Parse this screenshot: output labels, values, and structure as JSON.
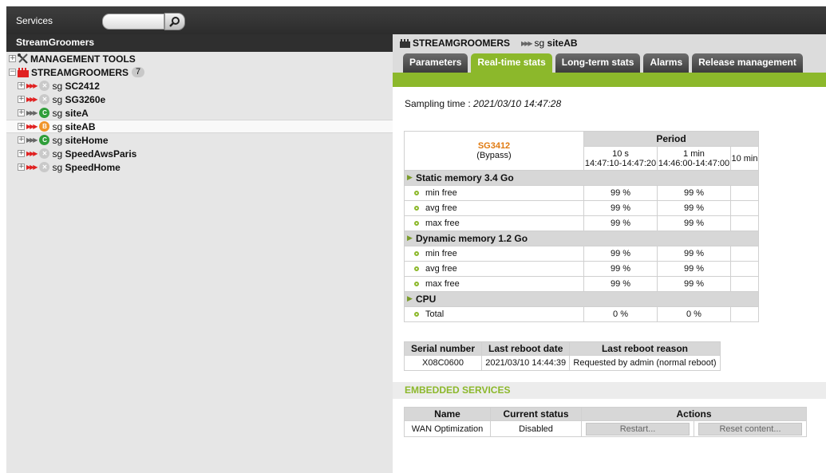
{
  "topbar": {
    "services_label": "Services",
    "search_placeholder": ""
  },
  "left": {
    "header": "StreamGroomers",
    "tree": {
      "management": "MANAGEMENT TOOLS",
      "root": {
        "label": "STREAMGROOMERS",
        "count": "7"
      },
      "items": [
        {
          "prefix": "sg",
          "name": "SC2412",
          "status": "X",
          "selected": false
        },
        {
          "prefix": "sg",
          "name": "SG3260e",
          "status": "X",
          "selected": false
        },
        {
          "prefix": "sg",
          "name": "siteA",
          "status": "C",
          "selected": false
        },
        {
          "prefix": "sg",
          "name": "siteAB",
          "status": "B",
          "selected": true
        },
        {
          "prefix": "sg",
          "name": "siteHome",
          "status": "C",
          "selected": false
        },
        {
          "prefix": "sg",
          "name": "SpeedAwsParis",
          "status": "X",
          "selected": false
        },
        {
          "prefix": "sg",
          "name": "SpeedHome",
          "status": "X",
          "selected": false
        }
      ]
    }
  },
  "breadcrumb": {
    "group": "STREAMGROOMERS",
    "prefix": "sg",
    "device": "siteAB"
  },
  "tabs": [
    "Parameters",
    "Real-time stats",
    "Long-term stats",
    "Alarms",
    "Release management"
  ],
  "active_tab": "Real-time stats",
  "sampling": {
    "label": "Sampling time :",
    "value": "2021/03/10 14:47:28"
  },
  "stats": {
    "device": "SG3412",
    "device_mode": "(Bypass)",
    "period_label": "Period",
    "periods": [
      {
        "label": "10 s",
        "range": "14:47:10-14:47:20"
      },
      {
        "label": "1 min",
        "range": "14:46:00-14:47:00"
      },
      {
        "label": "10 min",
        "range": ""
      }
    ],
    "sections": [
      {
        "title": "Static memory 3.4 Go",
        "rows": [
          {
            "label": "min free",
            "v1": "99 %",
            "v2": "99 %",
            "v3": ""
          },
          {
            "label": "avg free",
            "v1": "99 %",
            "v2": "99 %",
            "v3": ""
          },
          {
            "label": "max free",
            "v1": "99 %",
            "v2": "99 %",
            "v3": ""
          }
        ]
      },
      {
        "title": "Dynamic memory 1.2 Go",
        "rows": [
          {
            "label": "min free",
            "v1": "99 %",
            "v2": "99 %",
            "v3": ""
          },
          {
            "label": "avg free",
            "v1": "99 %",
            "v2": "99 %",
            "v3": ""
          },
          {
            "label": "max free",
            "v1": "99 %",
            "v2": "99 %",
            "v3": ""
          }
        ]
      },
      {
        "title": "CPU",
        "rows": [
          {
            "label": "Total",
            "v1": "0 %",
            "v2": "0 %",
            "v3": ""
          }
        ]
      }
    ]
  },
  "reboot": {
    "headers": [
      "Serial number",
      "Last reboot date",
      "Last reboot reason"
    ],
    "row": [
      "X08C0600",
      "2021/03/10 14:44:39",
      "Requested by admin (normal reboot)"
    ]
  },
  "embedded": {
    "title": "EMBEDDED SERVICES",
    "headers": [
      "Name",
      "Current status",
      "Actions"
    ],
    "rows": [
      {
        "name": "WAN Optimization",
        "status": "Disabled",
        "restart": "Restart...",
        "reset": "Reset content..."
      }
    ]
  },
  "colors": {
    "accent": "#8cb82b",
    "device": "#e07a10",
    "active_red": "#e02020"
  }
}
